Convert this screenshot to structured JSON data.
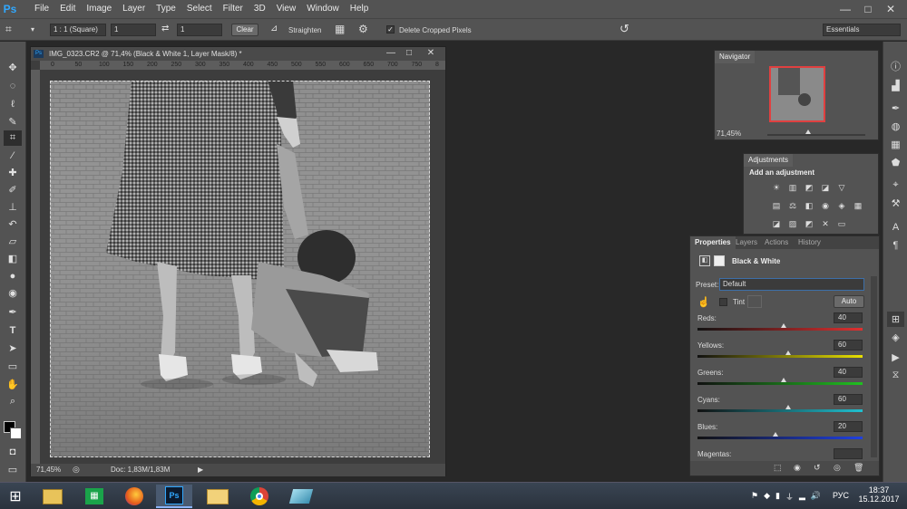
{
  "app": {
    "logo": "Ps"
  },
  "menu": [
    "File",
    "Edit",
    "Image",
    "Layer",
    "Type",
    "Select",
    "Filter",
    "3D",
    "View",
    "Window",
    "Help"
  ],
  "window_controls": {
    "minimize": "—",
    "maximize": "□",
    "close": "✕"
  },
  "options": {
    "ratio": "1 : 1 (Square)",
    "width": "1",
    "height": "1",
    "clear_label": "Clear",
    "straighten_label": "Straighten",
    "delete_cropped_label": "Delete Cropped Pixels",
    "delete_cropped_checked": true,
    "workspace": "Essentials"
  },
  "document": {
    "title": "IMG_0323.CR2 @ 71,4% (Black & White 1, Layer Mask/8) *",
    "ruler_ticks": [
      "0",
      "50",
      "100",
      "150",
      "200",
      "250",
      "300",
      "350",
      "400",
      "450",
      "500",
      "550",
      "600",
      "650",
      "700",
      "750",
      "8"
    ],
    "zoom": "71,45%",
    "doc_info": "Doc: 1,83M/1,83M"
  },
  "navigator": {
    "title": "Navigator",
    "zoom": "71,45%"
  },
  "adjustments": {
    "title": "Adjustments",
    "subtitle": "Add an adjustment"
  },
  "properties": {
    "tabs": [
      "Properties",
      "Layers",
      "Actions",
      "History"
    ],
    "layer_title": "Black & White",
    "preset_label": "Preset:",
    "preset_value": "Default",
    "tint_label": "Tint",
    "auto_label": "Auto",
    "sliders": [
      {
        "label": "Reds:",
        "value": "40",
        "color": "#e03030",
        "pos": 0.52
      },
      {
        "label": "Yellows:",
        "value": "60",
        "color": "#e8e000",
        "pos": 0.55
      },
      {
        "label": "Greens:",
        "value": "40",
        "color": "#20c020",
        "pos": 0.52
      },
      {
        "label": "Cyans:",
        "value": "60",
        "color": "#20c0d0",
        "pos": 0.55
      },
      {
        "label": "Blues:",
        "value": "20",
        "color": "#2040e0",
        "pos": 0.47
      },
      {
        "label": "Magentas:",
        "value": "",
        "color": "#d020d0",
        "pos": 0.5
      }
    ]
  },
  "taskbar": {
    "time": "18:37",
    "date": "15.12.2017",
    "lang": "РУС"
  },
  "colors": {
    "accent": "#31a8ff",
    "panel": "#535353",
    "dark": "#282828"
  }
}
